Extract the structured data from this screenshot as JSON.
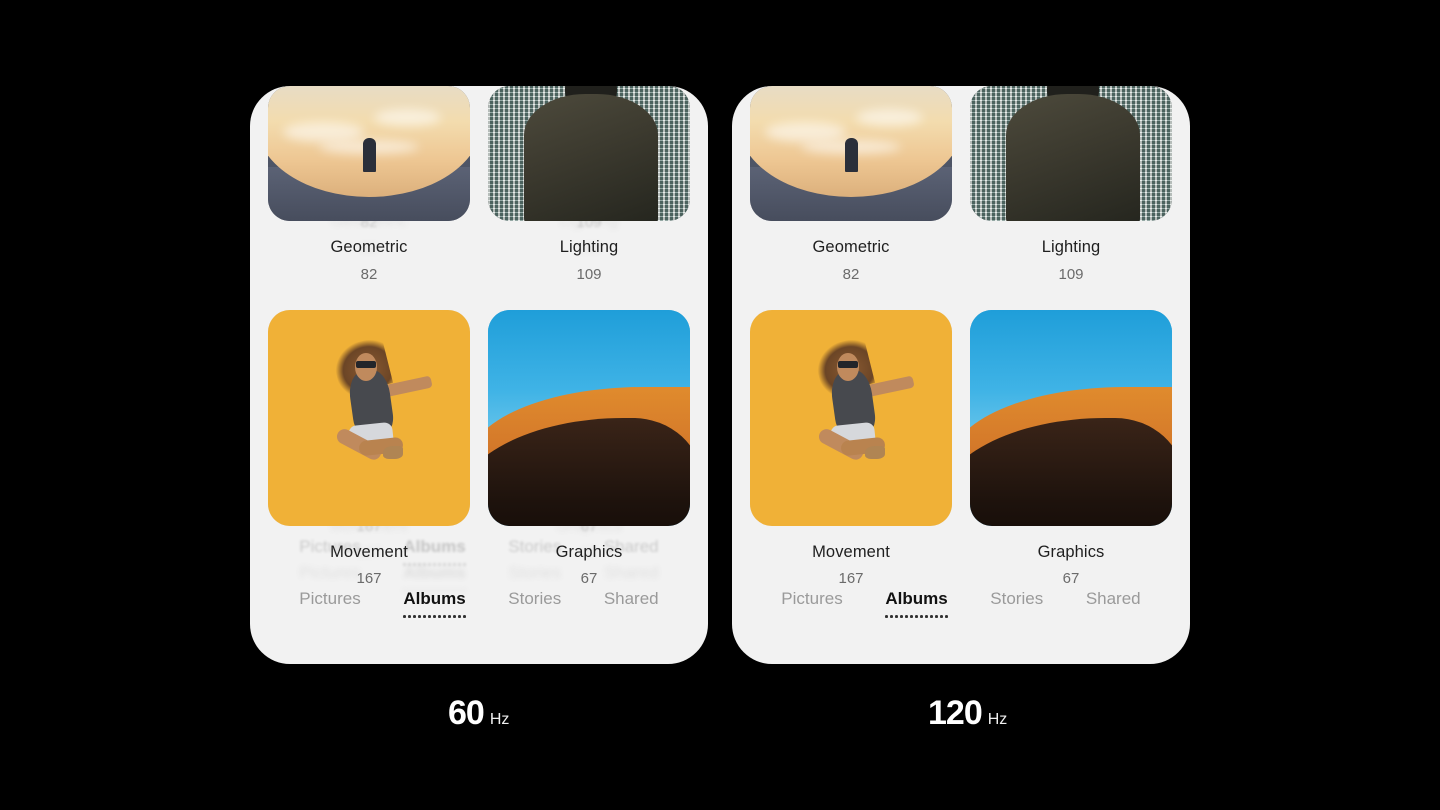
{
  "background_color": "#000000",
  "panels": [
    {
      "id": "panel-60hz",
      "refresh_rate_number": "60",
      "refresh_rate_unit": "Hz",
      "motion_blur": true,
      "screen_bg": "#f2f2f2",
      "albums": [
        {
          "title": "Geometric",
          "count": "82",
          "art": "geometric",
          "shape": "wide"
        },
        {
          "title": "Lighting",
          "count": "109",
          "art": "lighting",
          "shape": "wide"
        },
        {
          "title": "Movement",
          "count": "167",
          "art": "movement",
          "shape": "square"
        },
        {
          "title": "Graphics",
          "count": "67",
          "art": "graphics",
          "shape": "square"
        }
      ],
      "tabs": [
        {
          "label": "Pictures",
          "active": false
        },
        {
          "label": "Albums",
          "active": true
        },
        {
          "label": "Stories",
          "active": false
        },
        {
          "label": "Shared",
          "active": false
        }
      ]
    },
    {
      "id": "panel-120hz",
      "refresh_rate_number": "120",
      "refresh_rate_unit": "Hz",
      "motion_blur": false,
      "screen_bg": "#f2f2f2",
      "albums": [
        {
          "title": "Geometric",
          "count": "82",
          "art": "geometric",
          "shape": "wide"
        },
        {
          "title": "Lighting",
          "count": "109",
          "art": "lighting",
          "shape": "wide"
        },
        {
          "title": "Movement",
          "count": "167",
          "art": "movement",
          "shape": "square"
        },
        {
          "title": "Graphics",
          "count": "67",
          "art": "graphics",
          "shape": "square"
        }
      ],
      "tabs": [
        {
          "label": "Pictures",
          "active": false
        },
        {
          "label": "Albums",
          "active": true
        },
        {
          "label": "Stories",
          "active": false
        },
        {
          "label": "Shared",
          "active": false
        }
      ]
    }
  ],
  "colors": {
    "title_text": "#1f1f1f",
    "count_text": "#6b6b6b",
    "tab_inactive": "#9a9a9a",
    "tab_active": "#111111",
    "hz_text": "#ffffff"
  }
}
